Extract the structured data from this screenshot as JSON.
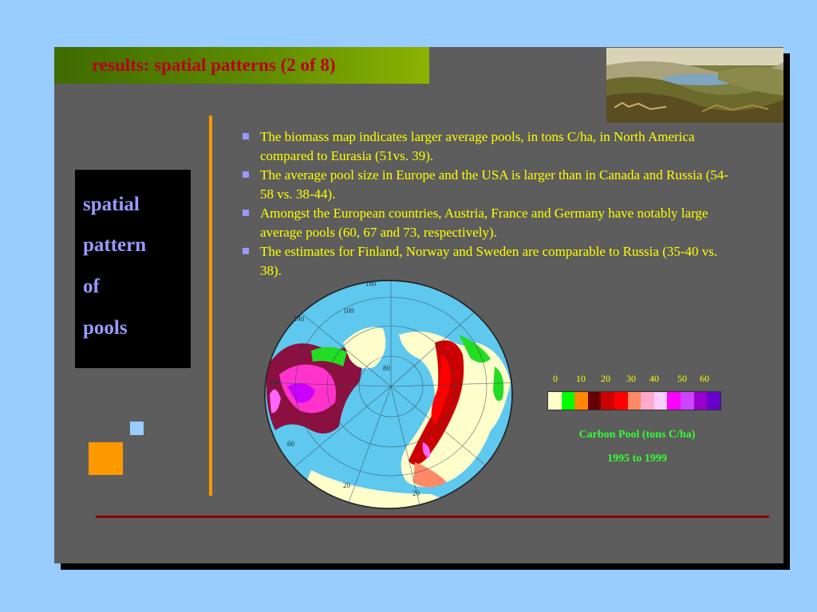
{
  "title": "results: spatial patterns (2 of 8)",
  "side_words": [
    "spatial",
    "pattern",
    "of",
    "pools"
  ],
  "bullets": [
    "The biomass map indicates larger average pools, in tons C/ha, in North America compared to Eurasia (51vs. 39).",
    "The average pool size in Europe and the USA is larger than in Canada and Russia (54-58 vs. 38-44).",
    "Amongst the European countries, Austria, France and Germany have notably large average pools (60, 67 and 73, respectively).",
    "The estimates for Finland, Norway and Sweden are comparable to Russia (35-40 vs. 38)."
  ],
  "map_labels": {
    "lon_top": "180",
    "lon_140": "140",
    "lon_100": "100",
    "lon_60": "60",
    "lon_20": "20",
    "lat_80": "80",
    "lat_100": "100",
    "lat_20": "20",
    "lat_60": "60"
  },
  "legend": {
    "ticks": [
      "0",
      "10",
      "20",
      "30",
      "40",
      "50",
      "60"
    ],
    "colors": [
      "#ffffcc",
      "#00ff00",
      "#ff8800",
      "#660000",
      "#cc0000",
      "#ff0000",
      "#ff8866",
      "#ffaacc",
      "#ffccff",
      "#ff00ff",
      "#cc44ff",
      "#9900cc",
      "#6600cc"
    ],
    "caption_line1": "Carbon Pool (tons C/ha)",
    "caption_line2": "1995 to 1999"
  }
}
